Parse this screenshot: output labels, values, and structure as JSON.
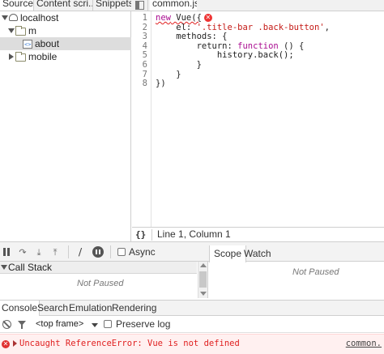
{
  "navigator": {
    "tabs": [
      {
        "label": "Sources"
      },
      {
        "label": "Content scri..."
      },
      {
        "label": "Snippets"
      }
    ],
    "tree": [
      {
        "label": "localhost"
      },
      {
        "label": "m"
      },
      {
        "label": "about"
      },
      {
        "label": "mobile"
      }
    ]
  },
  "editor": {
    "tab_label": "common.js",
    "line_numbers": [
      "1",
      "2",
      "3",
      "4",
      "5",
      "6",
      "7",
      "8"
    ],
    "lines": [
      {
        "kw": "new",
        "rest": " Vue({"
      },
      {
        "plain": "    el: ",
        "str": "'.title-bar .back-button'",
        "after": ","
      },
      {
        "plain": "    methods: {"
      },
      {
        "plain": "        return: ",
        "kw": "function",
        "after": " () {"
      },
      {
        "plain": "            history.back();"
      },
      {
        "plain": "        }"
      },
      {
        "plain": "    }"
      },
      {
        "plain": "})"
      }
    ],
    "status": {
      "braces": "{}",
      "position": "Line 1, Column 1"
    }
  },
  "debugger": {
    "async_label": "Async",
    "call_stack": {
      "title": "Call Stack",
      "empty": "Not Paused"
    },
    "scope_tabs": [
      {
        "label": "Scope"
      },
      {
        "label": "Watch"
      }
    ],
    "scope_empty": "Not Paused"
  },
  "drawer": {
    "tabs": [
      {
        "label": "Console"
      },
      {
        "label": "Search"
      },
      {
        "label": "Emulation"
      },
      {
        "label": "Rendering"
      }
    ],
    "frame_select": "<top frame>",
    "preserve_log_label": "Preserve log",
    "message": {
      "text": "Uncaught ReferenceError: Vue is not defined",
      "source": "common."
    }
  },
  "colors": {
    "error": "#e02020",
    "keyword": "#aa0d91",
    "string": "#c41a16"
  }
}
